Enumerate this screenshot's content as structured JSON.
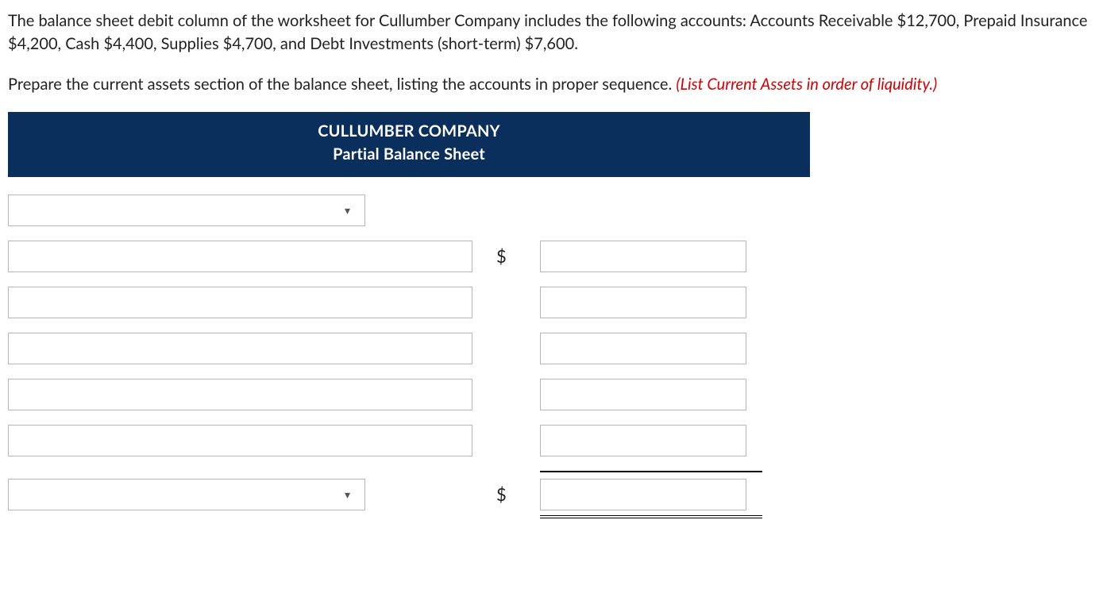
{
  "paragraph1": "The balance sheet debit column of the worksheet for Cullumber Company includes the following accounts: Accounts Receivable $12,700, Prepaid Insurance $4,200, Cash $4,400, Supplies $4,700, and Debt Investments (short-term) $7,600.",
  "instruction_lead": "Prepare the current assets section of the balance sheet, listing the accounts in proper sequence. ",
  "instruction_hint": "(List Current Assets in order of liquidity.)",
  "header_line1": "CULLUMBER COMPANY",
  "header_line2": "Partial Balance Sheet",
  "currency_symbol": "$",
  "fields": {
    "section_select": "",
    "account1": "",
    "amount1": "",
    "account2": "",
    "amount2": "",
    "account3": "",
    "amount3": "",
    "account4": "",
    "amount4": "",
    "account5": "",
    "amount5": "",
    "total_select": "",
    "total_amount": ""
  }
}
